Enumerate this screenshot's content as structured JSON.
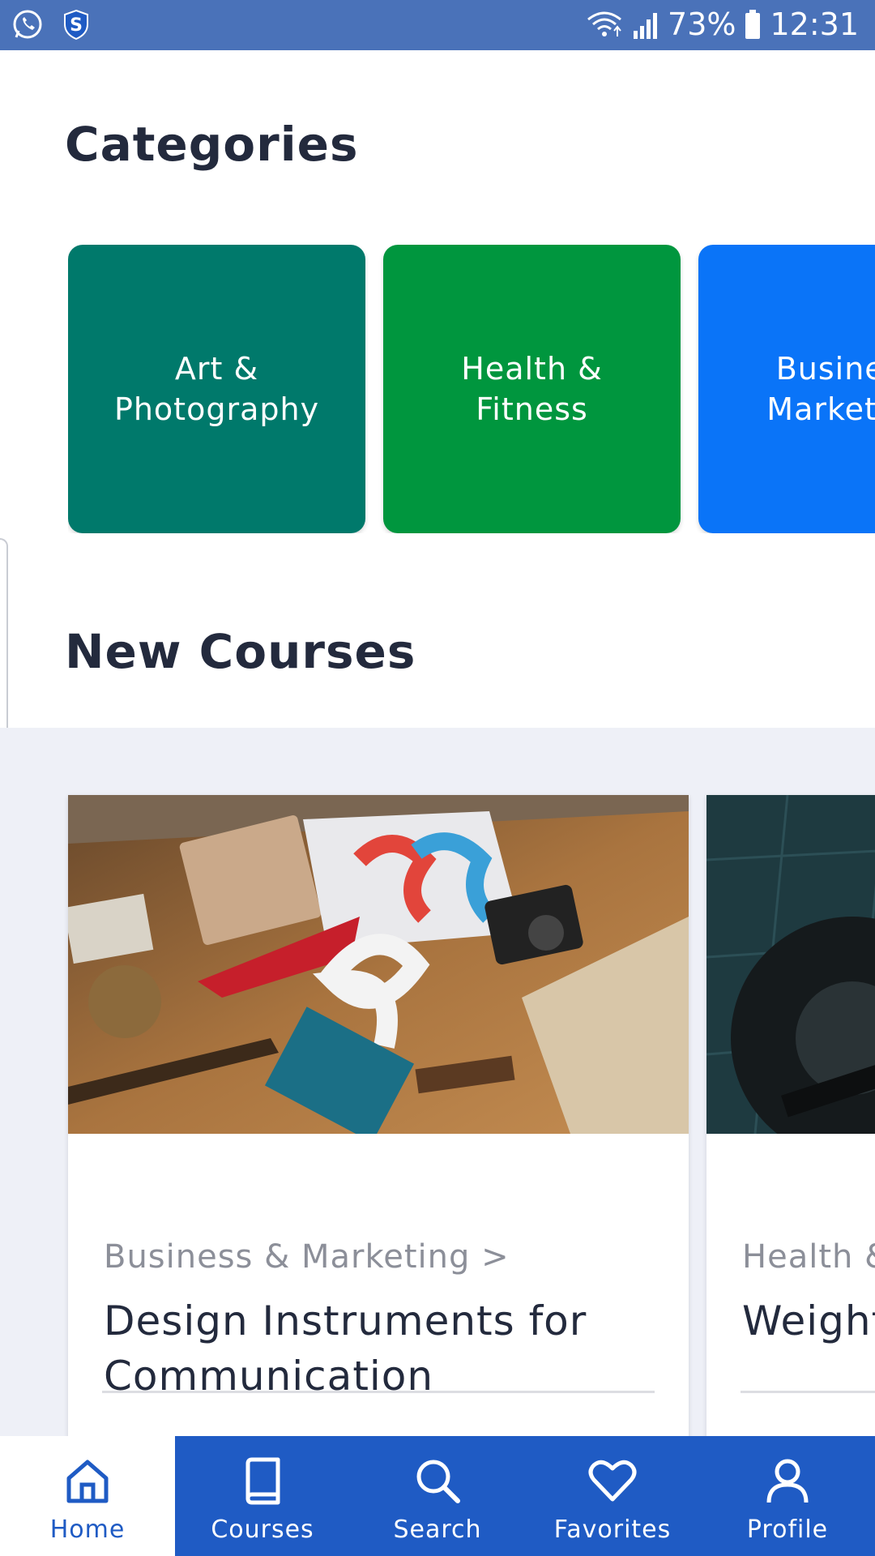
{
  "status_bar": {
    "battery": "73%",
    "time": "12:31",
    "icons": [
      "whatsapp-icon",
      "shield-s-icon",
      "wifi-icon",
      "signal-icon",
      "battery-icon"
    ]
  },
  "categories": {
    "title": "Categories",
    "items": [
      {
        "label_line1": "Art &",
        "label_line2": "Photography",
        "color": "#00796b"
      },
      {
        "label_line1": "Health &",
        "label_line2": "Fitness",
        "color": "#00963e"
      },
      {
        "label_line1": "Business",
        "label_line2": "Marketing",
        "color": "#0a74f8"
      }
    ]
  },
  "new_courses": {
    "title": "New Courses",
    "items": [
      {
        "category": "Business & Marketing >",
        "title": "Design Instruments for Communication"
      },
      {
        "category": "Health & Fitness >",
        "title": "Weight Training with Arms"
      }
    ]
  },
  "bottom_nav": {
    "items": [
      {
        "label": "Home",
        "icon": "home-icon",
        "active": true
      },
      {
        "label": "Courses",
        "icon": "book-icon",
        "active": false
      },
      {
        "label": "Search",
        "icon": "search-icon",
        "active": false
      },
      {
        "label": "Favorites",
        "icon": "heart-icon",
        "active": false
      },
      {
        "label": "Profile",
        "icon": "user-icon",
        "active": false
      }
    ]
  },
  "colors": {
    "status_bar": "#4a72b9",
    "nav_bar": "#1f5bc4",
    "heading": "#232a3d",
    "band": "#eef0f7"
  }
}
